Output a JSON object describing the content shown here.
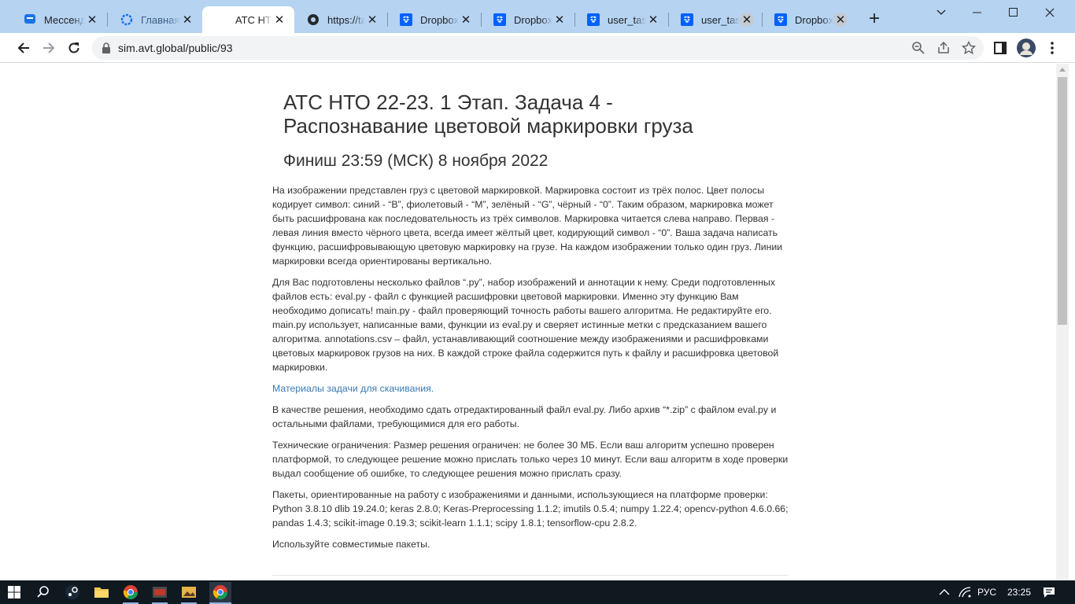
{
  "tabs": [
    {
      "title": "Мессендж",
      "icon": "messenger-icon"
    },
    {
      "title": "Главная с",
      "icon": "gear-icon"
    },
    {
      "title": "АТС НТО",
      "icon": "blank-icon"
    },
    {
      "title": "https://tal",
      "icon": "github-icon"
    },
    {
      "title": "Dropbox -",
      "icon": "dropbox-icon"
    },
    {
      "title": "Dropbox -",
      "icon": "dropbox-icon"
    },
    {
      "title": "user_task",
      "icon": "dropbox-icon"
    },
    {
      "title": "user_task",
      "icon": "dropbox-icon"
    },
    {
      "title": "Dropbox -",
      "icon": "dropbox-icon"
    }
  ],
  "address": {
    "url": "sim.avt.global/public/93"
  },
  "article": {
    "title": "АТС НТО 22-23. 1 Этап. Задача 4 - Распознавание цветовой маркировки груза",
    "subtitle": "Финиш 23:59 (МСК) 8 ноября 2022",
    "p1": "На изображении представлен груз с цветовой маркировкой. Маркировка состоит из трёх полос. Цвет полосы кодирует символ: синий - “B”, фиолетовый - “M”, зелёный - “G”, чёрный - “0”. Таким образом, маркировка может быть расшифрована как последовательность из трёх символов. Маркировка читается слева направо. Первая - левая линия вместо чёрного цвета, всегда имеет жёлтый цвет, кодирующий символ - “0”. Ваша задача написать функцию, расшифровывающую цветовую маркировку на грузе. На каждом изображении только один груз. Линии маркировки всегда ориентированы вертикально.",
    "p2": "Для Вас подготовлены несколько файлов “.py”, набор изображений и аннотации к нему. Среди подготовленных файлов есть: eval.py - файл с функцией расшифровки цветовой маркировки. Именно эту функцию Вам необходимо дописать! main.py - файл проверяющий точность работы вашего алгоритма. Не редактируйте его. main.py использует, написанные вами, функции из eval.py и сверяет истинные метки с предсказанием вашего алгоритма. annotations.csv – файл, устанавливающий соотношение между изображениями и расшифровками цветовых маркировок грузов на них. В каждой строке файла содержится путь к файлу и расшифровка цветовой маркировки.",
    "link": "Материалы задачи для скачивания.",
    "p3": "В качестве решения, необходимо сдать отредактированный файл eval.py. Либо архив “*.zip” с файлом eval.py и остальными файлами, требующимися для его работы.",
    "p4": "Технические ограничения: Размер решения ограничен: не более 30 МБ. Если ваш алгоритм успешно проверен платформой, то следующее решение можно прислать только через 10 минут. Если ваш алгоритм в ходе проверки выдал сообщение об ошибке, то следующее решения можно прислать сразу.",
    "p5": "Пакеты, ориентированные на работу с изображениями и данными, использующиеся на платформе проверки: Python 3.8.10 dlib 19.24.0; keras 2.8.0; Keras-Preprocessing 1.1.2; imutils 0.5.4; numpy 1.22.4; opencv-python 4.6.0.66; pandas 1.4.3; scikit-image 0.19.3; scikit-learn 1.1.1; scipy 1.8.1; tensorflow-cpu 2.8.2.",
    "p6": "Используйте совместимые пакеты."
  },
  "taskbar": {
    "lang": "РУС",
    "time": "23:25"
  }
}
